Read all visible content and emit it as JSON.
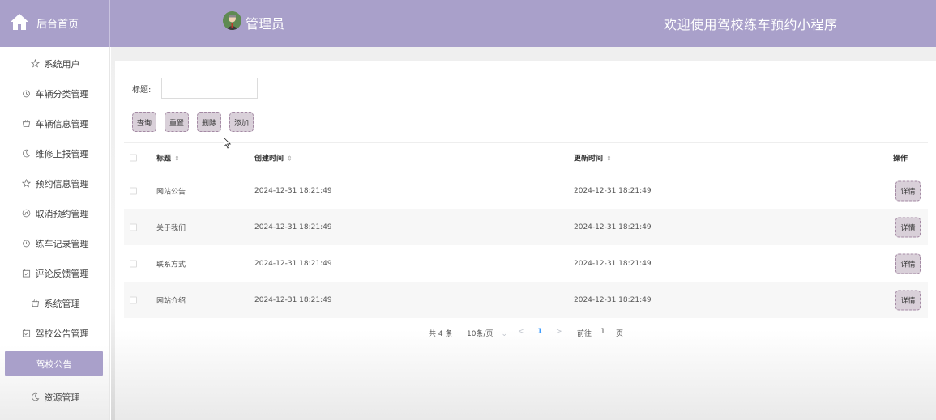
{
  "header": {
    "home_label": "后台首页",
    "admin_name": "管理员",
    "welcome": "欢迎使用驾校练车预约小程序"
  },
  "sidebar": {
    "items": [
      {
        "label": "系统用户",
        "icon": "star-icon"
      },
      {
        "label": "车辆分类管理",
        "icon": "timer-icon"
      },
      {
        "label": "车辆信息管理",
        "icon": "basket-icon"
      },
      {
        "label": "维修上报管理",
        "icon": "moon-icon"
      },
      {
        "label": "预约信息管理",
        "icon": "star-icon"
      },
      {
        "label": "取消预约管理",
        "icon": "compass-icon"
      },
      {
        "label": "练车记录管理",
        "icon": "timer-icon"
      },
      {
        "label": "评论反馈管理",
        "icon": "calendar-check-icon"
      },
      {
        "label": "系统管理",
        "icon": "basket-icon"
      },
      {
        "label": "驾校公告管理",
        "icon": "calendar-check-icon"
      },
      {
        "label": "驾校公告",
        "icon": "",
        "active": true
      },
      {
        "label": "资源管理",
        "icon": "moon-icon"
      }
    ]
  },
  "search": {
    "title_label": "标题:",
    "title_value": "",
    "buttons": {
      "query": "查询",
      "reset": "重置",
      "delete": "删除",
      "add": "添加"
    }
  },
  "table": {
    "headers": {
      "title": "标题",
      "created": "创建时间",
      "updated": "更新时间",
      "actions": "操作"
    },
    "rows": [
      {
        "title": "网站公告",
        "created": "2024-12-31 18:21:49",
        "updated": "2024-12-31 18:21:49",
        "action": "详情"
      },
      {
        "title": "关于我们",
        "created": "2024-12-31 18:21:49",
        "updated": "2024-12-31 18:21:49",
        "action": "详情"
      },
      {
        "title": "联系方式",
        "created": "2024-12-31 18:21:49",
        "updated": "2024-12-31 18:21:49",
        "action": "详情"
      },
      {
        "title": "网站介绍",
        "created": "2024-12-31 18:21:49",
        "updated": "2024-12-31 18:21:49",
        "action": "详情"
      }
    ]
  },
  "pagination": {
    "total": "共 4 条",
    "page_size": "10条/页",
    "prev": "<",
    "current": "1",
    "next": ">",
    "goto_label": "前往",
    "goto_value": "1",
    "page_suffix": "页"
  },
  "colors": {
    "accent": "#a9a0ca",
    "button_bg": "#d9d0d9",
    "button_border": "#a48aa4"
  }
}
